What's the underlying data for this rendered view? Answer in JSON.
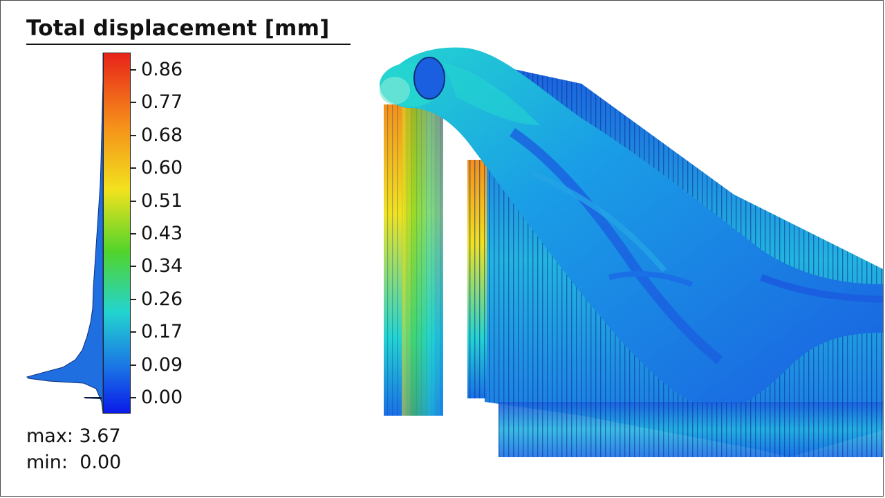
{
  "legend": {
    "title": "Total displacement [mm]",
    "ticks": [
      "0.86",
      "0.77",
      "0.68",
      "0.60",
      "0.51",
      "0.43",
      "0.34",
      "0.26",
      "0.17",
      "0.09",
      "0.00"
    ],
    "colors": {
      "top": "#e8231a",
      "orange": "#f58f1a",
      "yellow": "#f2e21e",
      "green": "#52d42a",
      "cyan": "#23d4d0",
      "blue": "#1a6fe6",
      "bottom": "#0a1ae8"
    },
    "histogram_color": "#1f6fe0"
  },
  "stats": {
    "max_label": "max:",
    "max_value": "3.67",
    "min_label": "min:",
    "min_value": "0.00"
  }
}
